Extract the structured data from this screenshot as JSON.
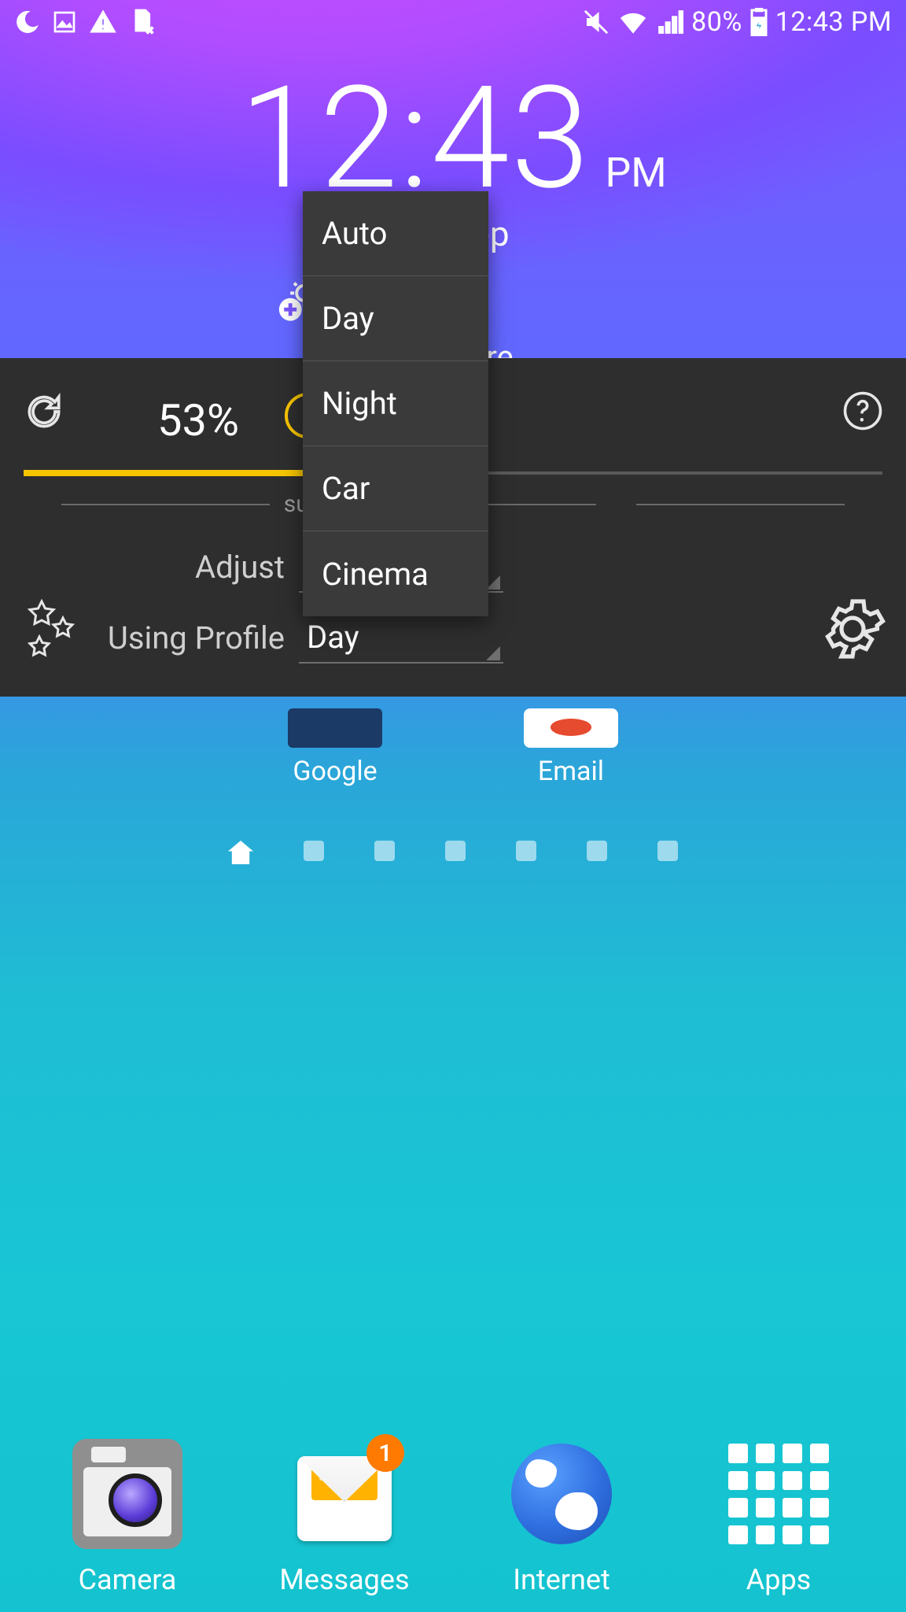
{
  "status": {
    "battery_text": "80%",
    "clock": "12:43 PM"
  },
  "clock": {
    "time": "12:43",
    "ampm": "PM",
    "date": "Fri, Sep"
  },
  "tap_hint": "Tap here",
  "panel": {
    "percent": "53%",
    "range_left": "sub-zero",
    "slider_fill_pct": 53,
    "adjust_label": "Adjust",
    "profile_label": "Using Profile",
    "profile_value": "Day"
  },
  "dropdown": {
    "options": [
      "Auto",
      "Day",
      "Night",
      "Car",
      "Cinema"
    ]
  },
  "home": {
    "google": "Google",
    "email": "Email"
  },
  "dock": {
    "camera": "Camera",
    "messages": "Messages",
    "messages_badge": "1",
    "internet": "Internet",
    "apps": "Apps"
  }
}
